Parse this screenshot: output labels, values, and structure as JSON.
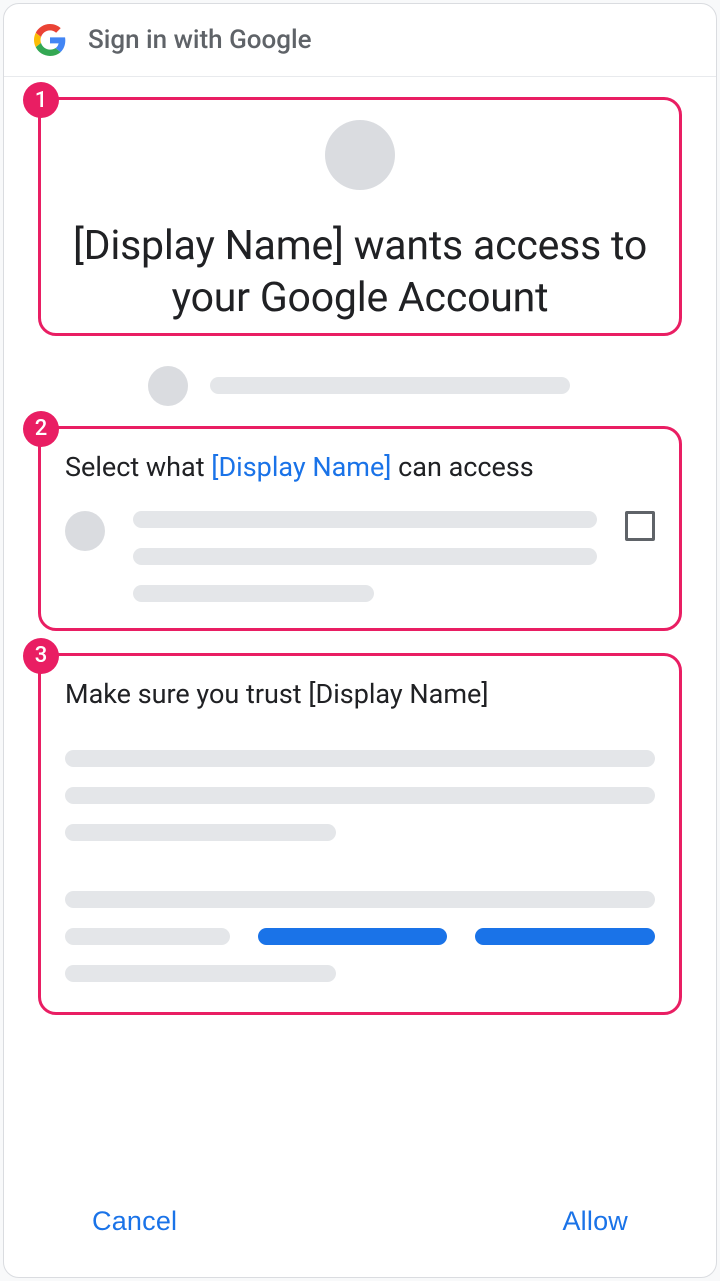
{
  "header": {
    "title": "Sign in with Google"
  },
  "badges": {
    "one": "1",
    "two": "2",
    "three": "3"
  },
  "section1": {
    "title": "[Display Name] wants access to your Google Account"
  },
  "section2": {
    "title_pre": "Select what ",
    "title_link": "[Display Name]",
    "title_post": " can access"
  },
  "section3": {
    "title": "Make sure you trust [Display Name]"
  },
  "footer": {
    "cancel": "Cancel",
    "allow": "Allow"
  }
}
